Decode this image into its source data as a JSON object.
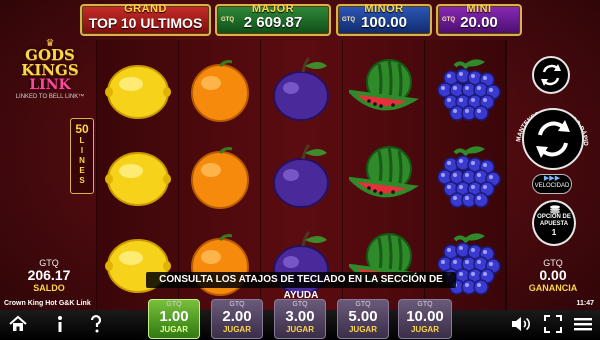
{
  "jackpots": {
    "grand": {
      "label": "GRAND",
      "value": "TOP 10 ULTIMOS"
    },
    "major": {
      "label": "MAJOR",
      "currency": "GTQ",
      "value": "2 609.87"
    },
    "minor": {
      "label": "MINOR",
      "currency": "GTQ",
      "value": "100.00"
    },
    "mini": {
      "label": "MINI",
      "currency": "GTQ",
      "value": "20.00"
    }
  },
  "logo": {
    "line1": "GODS",
    "line2": "KINGS",
    "line3": "LINK",
    "tagline": "LINKED TO BELL LINK™"
  },
  "lines": {
    "count": "50",
    "word": [
      "L",
      "I",
      "N",
      "E",
      "S"
    ]
  },
  "reels": [
    [
      "lemon-icon",
      "lemon-icon",
      "lemon-icon"
    ],
    [
      "orange-icon",
      "orange-icon",
      "orange-icon"
    ],
    [
      "plum-icon",
      "plum-icon",
      "plum-icon"
    ],
    [
      "watermelon-icon",
      "watermelon-icon",
      "watermelon-icon"
    ],
    [
      "grapes-icon",
      "grapes-icon",
      "grapes-icon"
    ]
  ],
  "notice": "CONSULTA LOS ATAJOS DE TECLADO EN LA SECCIÓN DE AYUDA",
  "controls": {
    "turbo_label": "MANTENER PARA JUEGO RÁPIDO",
    "speed_label": "VELOCIDAD",
    "bet_option_line1": "OPCIÓN DE",
    "bet_option_line2": "APUESTA",
    "bet_option_value": "1"
  },
  "balance": {
    "currency": "GTQ",
    "value": "206.17",
    "label": "SALDO"
  },
  "win": {
    "currency": "GTQ",
    "value": "0.00",
    "label": "GANANCIA"
  },
  "game_name": "Crown King Hot G&K Link",
  "clock": "11:47",
  "bets": [
    {
      "currency": "GTQ",
      "value": "1.00",
      "action": "JUGAR"
    },
    {
      "currency": "GTQ",
      "value": "2.00",
      "action": "JUGAR"
    },
    {
      "currency": "GTQ",
      "value": "3.00",
      "action": "JUGAR"
    },
    {
      "currency": "GTQ",
      "value": "5.00",
      "action": "JUGAR"
    },
    {
      "currency": "GTQ",
      "value": "10.00",
      "action": "JUGAR"
    }
  ],
  "colors": {
    "active_bet": "#4e9e22",
    "gold": "#ffd54a",
    "background": "#5c0c10"
  }
}
